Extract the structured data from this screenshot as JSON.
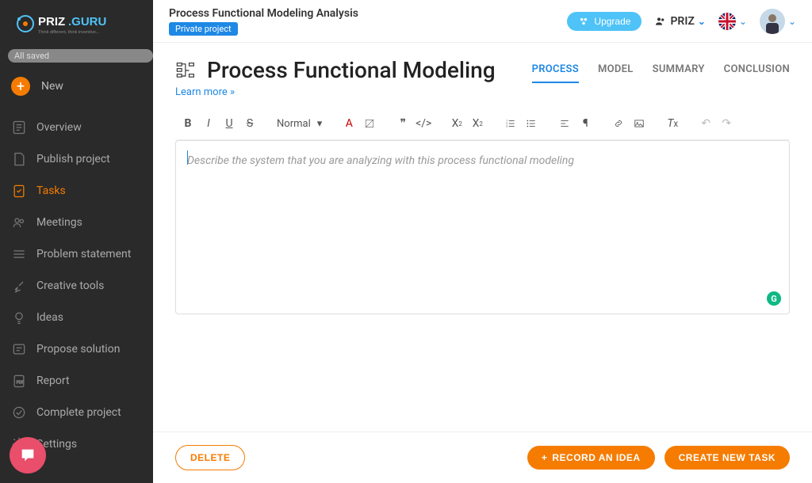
{
  "logo": {
    "brand1": "PRIZ",
    "brand2": ".GURU",
    "tagline": "Think different, think inventive..."
  },
  "saved_badge": "All saved",
  "new_button": "New",
  "sidebar": {
    "items": [
      {
        "label": "Overview"
      },
      {
        "label": "Publish project"
      },
      {
        "label": "Tasks"
      },
      {
        "label": "Meetings"
      },
      {
        "label": "Problem statement"
      },
      {
        "label": "Creative tools"
      },
      {
        "label": "Ideas"
      },
      {
        "label": "Propose solution"
      },
      {
        "label": "Report"
      },
      {
        "label": "Complete project"
      },
      {
        "label": "Settings"
      }
    ]
  },
  "topbar": {
    "title": "Process Functional Modeling Analysis",
    "badge": "Private project",
    "upgrade": "Upgrade",
    "workspace": "PRIZ"
  },
  "page": {
    "title": "Process Functional Modeling",
    "learn_more": "Learn more »"
  },
  "tabs": [
    {
      "label": "PROCESS"
    },
    {
      "label": "MODEL"
    },
    {
      "label": "SUMMARY"
    },
    {
      "label": "CONCLUSION"
    }
  ],
  "toolbar": {
    "format": "Normal"
  },
  "editor": {
    "placeholder": "Describe the system that you are analyzing with this process functional modeling"
  },
  "footer": {
    "delete": "DELETE",
    "record_idea": "RECORD AN IDEA",
    "create_task": "CREATE NEW TASK"
  },
  "grammar_badge": "G"
}
